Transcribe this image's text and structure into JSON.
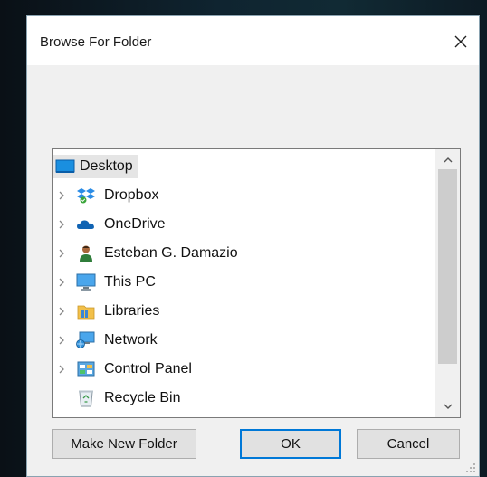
{
  "dialog": {
    "title": "Browse For Folder",
    "close_icon": "close-icon"
  },
  "tree": {
    "root": {
      "label": "Desktop",
      "icon": "desktop-icon"
    },
    "items": [
      {
        "label": "Dropbox",
        "icon": "dropbox-icon",
        "expandable": true
      },
      {
        "label": "OneDrive",
        "icon": "onedrive-icon",
        "expandable": true
      },
      {
        "label": "Esteban G. Damazio",
        "icon": "user-folder-icon",
        "expandable": true
      },
      {
        "label": "This PC",
        "icon": "computer-icon",
        "expandable": true
      },
      {
        "label": "Libraries",
        "icon": "libraries-icon",
        "expandable": true
      },
      {
        "label": "Network",
        "icon": "network-icon",
        "expandable": true
      },
      {
        "label": "Control Panel",
        "icon": "control-panel-icon",
        "expandable": true
      },
      {
        "label": "Recycle Bin",
        "icon": "recycle-bin-icon",
        "expandable": false
      }
    ]
  },
  "buttons": {
    "make_new_folder": "Make New Folder",
    "ok": "OK",
    "cancel": "Cancel"
  },
  "colors": {
    "accent": "#0078d7",
    "selection": "#e5e5e5",
    "dialog_bg": "#f0f0f0"
  }
}
